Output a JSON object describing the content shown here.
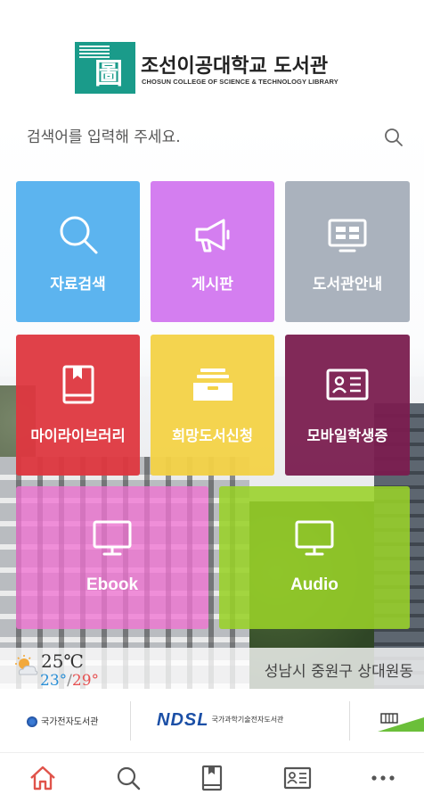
{
  "header": {
    "library_title": "조선이공대학교 도서관",
    "library_subtitle": "CHOSUN COLLEGE OF SCIENCE & TECHNOLOGY LIBRARY",
    "logo_glyph": "圖"
  },
  "search": {
    "placeholder": "검색어를 입력해 주세요."
  },
  "tiles": [
    {
      "label": "자료검색",
      "icon": "search-icon",
      "color": "#5cb4ef"
    },
    {
      "label": "게시판",
      "icon": "megaphone-icon",
      "color": "#d47ef0"
    },
    {
      "label": "도서관안내",
      "icon": "info-board-icon",
      "color": "#aab2bd"
    },
    {
      "label": "마이라이브러리",
      "icon": "book-icon",
      "color": "#de373f"
    },
    {
      "label": "희망도서신청",
      "icon": "inbox-tray-icon",
      "color": "#f3d246"
    },
    {
      "label": "모바일학생증",
      "icon": "id-card-icon",
      "color": "#7a1e4f"
    },
    {
      "label": "Ebook",
      "icon": "monitor-icon",
      "color": "#f073d2"
    },
    {
      "label": "Audio",
      "icon": "monitor-icon",
      "color": "#98d228"
    }
  ],
  "weather": {
    "icon": "partly-cloudy-icon",
    "current_temp": "25℃",
    "low_temp": "23°",
    "separator": "/",
    "high_temp": "29°",
    "location": "성남시 중원구 상대원동"
  },
  "partners": [
    {
      "name": "국가전자도서관",
      "icon": "national-digital-library-icon"
    },
    {
      "mark": "NDSL",
      "name": "국가과학기술전자도서관"
    },
    {
      "icon": "partner-logo-icon"
    }
  ],
  "bottom_nav": [
    {
      "icon": "home-icon",
      "active": true,
      "color": "#e0534a"
    },
    {
      "icon": "search-icon",
      "active": false
    },
    {
      "icon": "book-icon",
      "active": false
    },
    {
      "icon": "id-card-icon",
      "active": false
    },
    {
      "icon": "more-icon",
      "active": false
    }
  ]
}
